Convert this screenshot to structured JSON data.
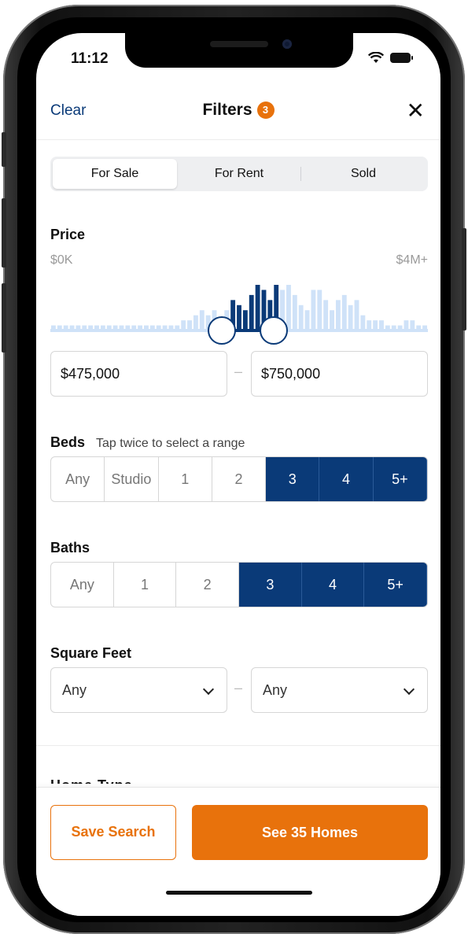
{
  "status": {
    "time": "11:12"
  },
  "header": {
    "clear_label": "Clear",
    "title": "Filters",
    "badge_count": "3",
    "close_label": "✕"
  },
  "listing_type": {
    "options": [
      "For Sale",
      "For Rent",
      "Sold"
    ],
    "selected": "For Sale"
  },
  "price": {
    "title": "Price",
    "min_label": "$0K",
    "max_label": "$4M+",
    "min_value": "$475,000",
    "max_value": "$750,000",
    "separator": "–",
    "histogram": [
      1,
      1,
      1,
      1,
      1,
      1,
      1,
      1,
      1,
      1,
      1,
      1,
      1,
      1,
      1,
      1,
      1,
      1,
      1,
      1,
      1,
      2,
      2,
      3,
      4,
      3,
      4,
      2,
      4,
      6,
      5,
      4,
      7,
      9,
      8,
      6,
      9,
      8,
      9,
      7,
      5,
      4,
      8,
      8,
      6,
      4,
      6,
      7,
      5,
      6,
      3,
      2,
      2,
      2,
      1,
      1,
      1,
      2,
      2,
      1,
      1
    ]
  },
  "beds": {
    "title": "Beds",
    "hint": "Tap twice to select a range",
    "options": [
      "Any",
      "Studio",
      "1",
      "2",
      "3",
      "4",
      "5+"
    ],
    "selected": [
      "3",
      "4",
      "5+"
    ]
  },
  "baths": {
    "title": "Baths",
    "options": [
      "Any",
      "1",
      "2",
      "3",
      "4",
      "5+"
    ],
    "selected": [
      "3",
      "4",
      "5+"
    ]
  },
  "square_feet": {
    "title": "Square Feet",
    "min": "Any",
    "max": "Any",
    "separator": "–"
  },
  "next_section_partial": "Home Type",
  "footer": {
    "save_label": "Save Search",
    "see_label": "See 35 Homes"
  },
  "colors": {
    "accent": "#e8720c",
    "primary": "#0a3a78",
    "histogram_selected": "#0a3a78",
    "histogram_unselected": "#cfe2f8"
  }
}
